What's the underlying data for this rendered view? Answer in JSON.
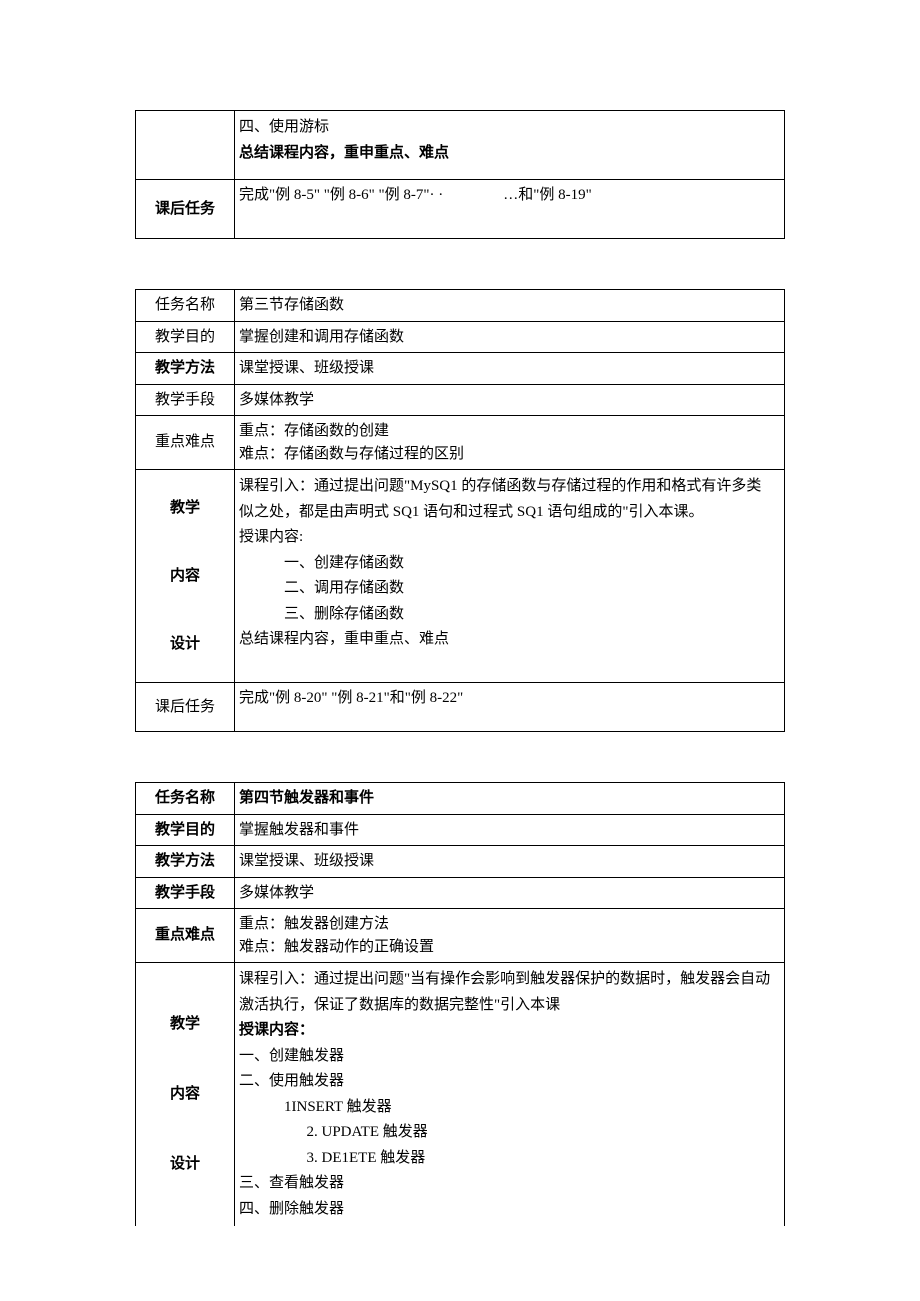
{
  "labels": {
    "taskName": "任务名称",
    "teachGoal": "教学目的",
    "teachMethod": "教学方法",
    "teachMeans": "教学手段",
    "keyDiff": "重点难点",
    "teach": "教学",
    "content": "内容",
    "design": "设计",
    "postTask": "课后任务"
  },
  "table1": {
    "contentLine1": "四、使用游标",
    "contentLine2": "总结课程内容，重申重点、难点",
    "postTaskA": "完成\"例 8-5\" \"例 8-6\" \"例 8-7\"· ·",
    "postTaskB": "…和\"例 8-19\""
  },
  "table2": {
    "taskName": "第三节存储函数",
    "teachGoal": "掌握创建和调用存储函数",
    "teachMethod": "课堂授课、班级授课",
    "teachMeans": "多媒体教学",
    "keyPoint": "重点：存储函数的创建",
    "diffPoint": "难点：存储函数与存储过程的区别",
    "introLine1": "课程引入：通过提出问题\"MySQ1 的存储函数与存储过程的作用和格式有许多类",
    "introLine2": "似之处，都是由声明式 SQ1 语句和过程式 SQ1 语句组成的\"引入本课。",
    "lectureHeader": "授课内容:",
    "item1": "一、创建存储函数",
    "item2": "二、调用存储函数",
    "item3": "三、删除存储函数",
    "summary": "总结课程内容，重申重点、难点",
    "postTask": "完成\"例 8-20\" \"例 8-21\"和\"例 8-22\""
  },
  "table3": {
    "taskName": "第四节触发器和事件",
    "teachGoal": "掌握触发器和事件",
    "teachMethod": "课堂授课、班级授课",
    "teachMeans": "多媒体教学",
    "keyPoint": "重点：触发器创建方法",
    "diffPoint": "难点：触发器动作的正确设置",
    "introLine1": "课程引入：通过提出问题\"当有操作会影响到触发器保护的数据时，触发器会自动",
    "introLine2": "激活执行，保证了数据库的数据完整性\"引入本课",
    "lectureHeader": "授课内容：",
    "item1": "一、创建触发器",
    "item2": "二、使用触发器",
    "sub1": "1INSERT 触发器",
    "sub2": "2.  UPDATE 触发器",
    "sub3": "3.  DE1ETE 触发器",
    "item3": "三、查看触发器",
    "item4": "四、删除触发器"
  }
}
